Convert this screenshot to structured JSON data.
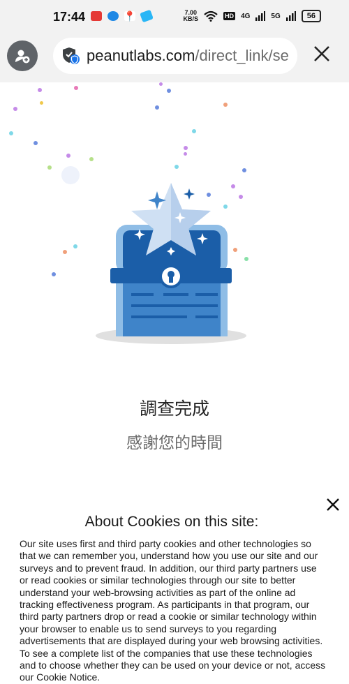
{
  "status_bar": {
    "time": "17:44",
    "speed_value": "7.00",
    "speed_unit": "KB/S",
    "hd": "HD",
    "sig1": "4G",
    "sig2": "5G",
    "battery": "56"
  },
  "browser": {
    "url_domain": "peanutlabs.com",
    "url_path": "/direct_link/se",
    "close_icon": "close-icon",
    "profile_icon": "profile-add-icon",
    "security_icon": "shield-icon"
  },
  "main": {
    "title": "調查完成",
    "subtitle": "感謝您的時間"
  },
  "cookie": {
    "title": "About Cookies on this site:",
    "body": "Our site uses first and third party cookies and other technologies so that we can remember you, understand how you use our site and our surveys and to prevent fraud. In addition, our third party partners use or read cookies or similar technologies through our site to better understand your web-browsing activities as part of the online ad tracking effectiveness program. As participants in that program, our third party partners drop or read a cookie or similar technology within your browser to enable us to send surveys to you regarding advertisements that are displayed during your web browsing activities. To see a complete list of the companies that use these technologies and to choose whether they can be used on your device or not, access our Cookie Notice.",
    "close_icon": "close-icon"
  },
  "colors": {
    "chest_dark": "#1b5ea8",
    "chest_mid": "#3f84c9",
    "chest_light": "#8fbde6",
    "star": "#cfe0f3",
    "accent": "#5a9fe0"
  }
}
